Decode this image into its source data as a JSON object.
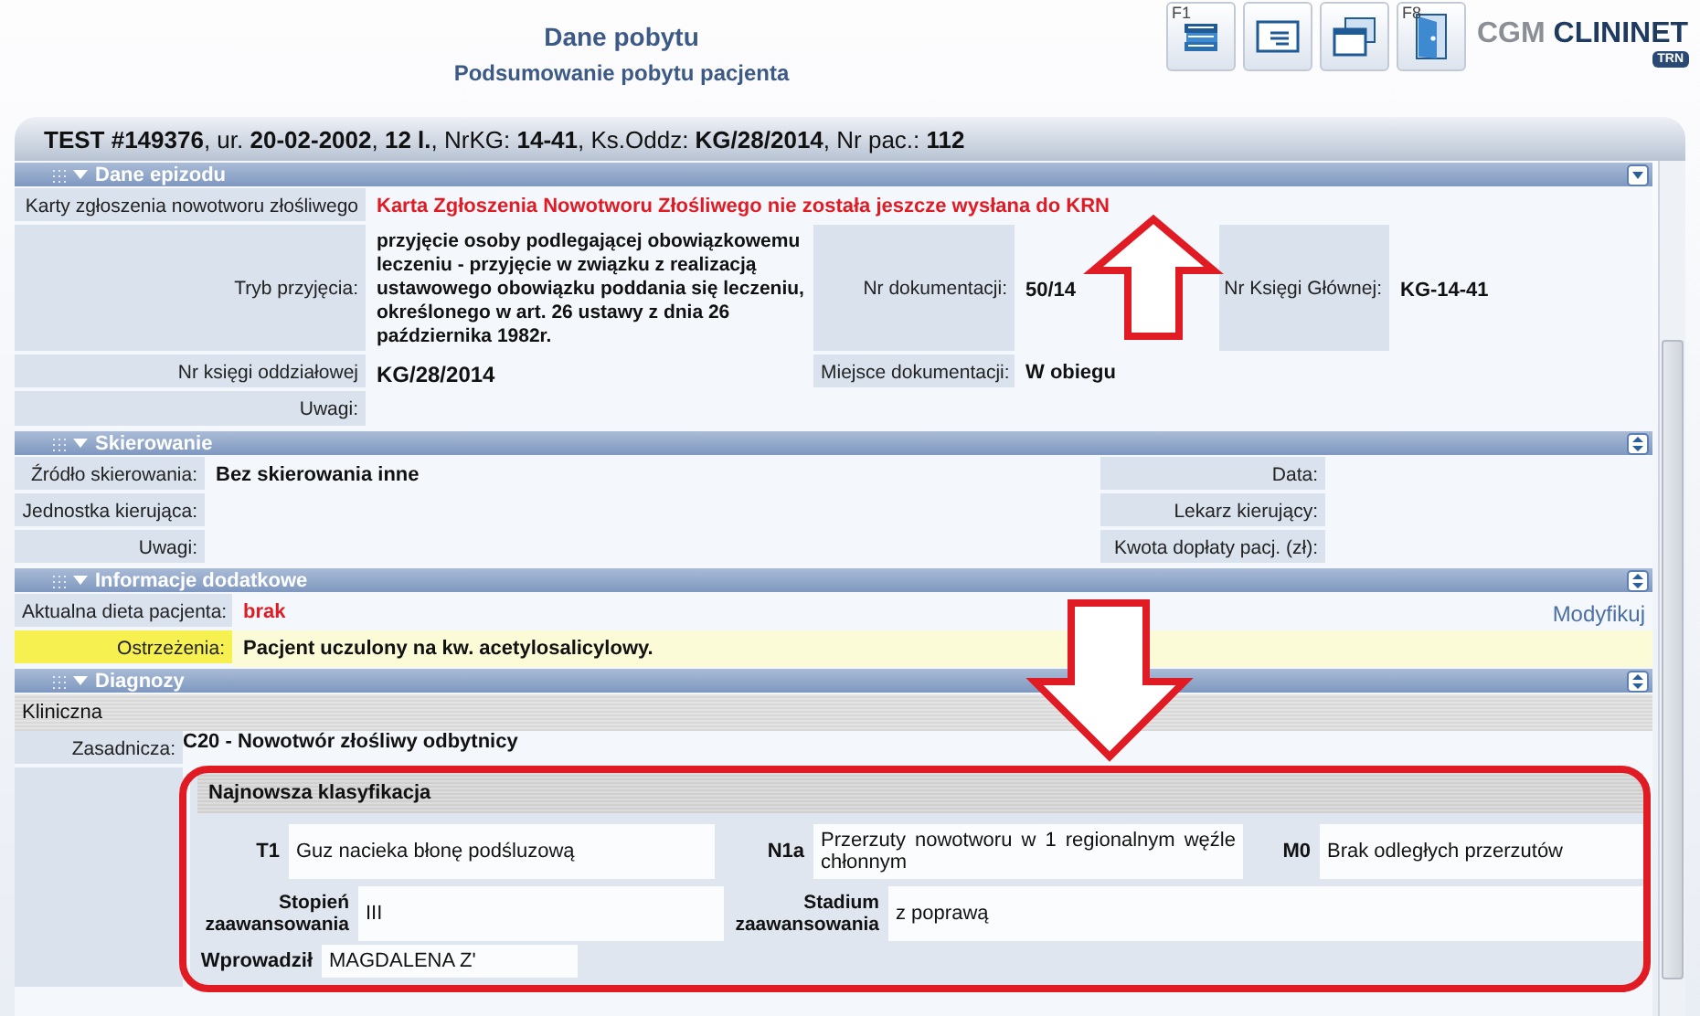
{
  "header": {
    "title": "Dane pobytu",
    "subtitle": "Podsumowanie pobytu pacjenta"
  },
  "toolbar": [
    {
      "kind": "books",
      "key": "F1"
    },
    {
      "kind": "card"
    },
    {
      "kind": "windows"
    },
    {
      "kind": "door",
      "key": "F8"
    }
  ],
  "logo": {
    "brand": "CGM",
    "product": "CLININET",
    "badge": "TRN"
  },
  "patient_bar": "**TEST #149376**, ur. **20-02-2002**, **12 l.**, NrKG: **14-41**, Ks.Oddz: **KG/28/2014**, Nr pac.: **112**",
  "episode": {
    "title": "Dane epizodu",
    "cancer_card_label": "Karty zgłoszenia nowotworu złośliwego",
    "cancer_card_value": "Karta Zgłoszenia Nowotworu Złośliwego nie została jeszcze wysłana do KRN",
    "admission_label": "Tryb przyjęcia:",
    "admission_value": "przyjęcie osoby podlegającej obowiązkowemu leczeniu - przyjęcie w związku z realizacją ustawowego obowiązku poddania się leczeniu, określonego w art. 26 ustawy z dnia 26 października 1982r.",
    "doc_number_label": "Nr dokumentacji:",
    "doc_number_value": "50/14",
    "main_book_label": "Nr Księgi Głównej:",
    "main_book_value": "KG-14-41",
    "ward_book_label": "Nr księgi oddziałowej",
    "ward_book_value": "KG/28/2014",
    "doc_place_label": "Miejsce dokumentacji:",
    "doc_place_value": "W obiegu",
    "notes_label": "Uwagi:"
  },
  "referral": {
    "title": "Skierowanie",
    "rows": [
      {
        "label": "Źródło skierowania:",
        "value": "Bez skierowania inne",
        "right_label": "Data:"
      },
      {
        "label": "Jednostka kierująca:",
        "right_label": "Lekarz kierujący:"
      },
      {
        "label": "Uwagi:",
        "right_label": "Kwota dopłaty pacj. (zł):"
      }
    ]
  },
  "additional": {
    "title": "Informacje dodatkowe",
    "diet_label": "Aktualna dieta pacjenta:",
    "diet_value": "brak",
    "modify_link": "Modyfikuj",
    "warning_label": "Ostrzeżenia:",
    "warning_value": "Pacjent uczulony na kw. acetylosalicylowy."
  },
  "diagnoses": {
    "title": "Diagnozy",
    "group": "Kliniczna",
    "main_label": "Zasadnicza:",
    "main_value": "C20 - Nowotwór złośliwy odbytnicy",
    "classification": {
      "title": "Najnowsza klasyfikacja",
      "tnm": [
        {
          "code": "T1",
          "text": "Guz nacieka błonę podśluzową"
        },
        {
          "code": "N1a",
          "text": "Przerzuty nowotworu w 1 regionalnym węźle chłonnym"
        },
        {
          "code": "M0",
          "text": "Brak odległych przerzutów"
        }
      ],
      "stage_label": "Stopień zaawansowania",
      "stage_value": "III",
      "status_label": "Stadium zaawansowania",
      "status_value": "z poprawą",
      "entered_label": "Wprowadził",
      "entered_value": "MAGDALENA Z'"
    }
  }
}
